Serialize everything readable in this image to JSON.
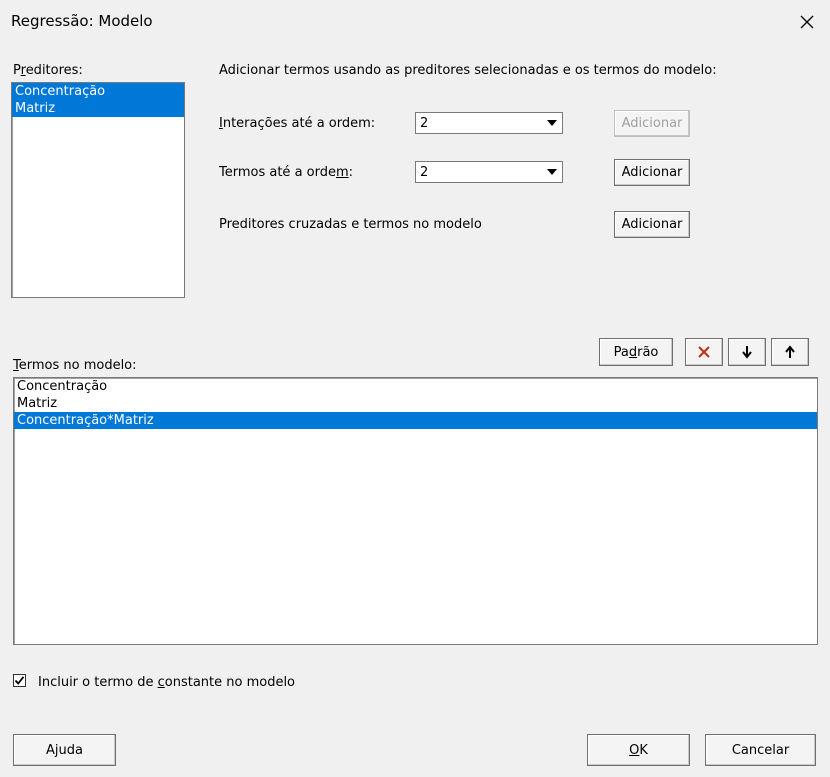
{
  "window": {
    "title": "Regressão: Modelo"
  },
  "predictors": {
    "label": "Preditores:",
    "items": [
      "Concentração",
      "Matriz"
    ]
  },
  "add_terms": {
    "heading": "Adicionar termos usando as preditores selecionadas e os termos do modelo:",
    "interactions_label": "Interações até a ordem:",
    "interactions_value": "2",
    "terms_label": "Termos até a ordem:",
    "terms_value": "2",
    "crossed_label": "Preditores cruzadas e termos no modelo",
    "add_button": "Adicionar"
  },
  "model_terms": {
    "label": "Termos no modelo:",
    "items": [
      "Concentração",
      "Matriz",
      "Concentração*Matriz"
    ],
    "default_button": "Padrão"
  },
  "constant": {
    "label": "Incluir o termo de constante no modelo",
    "checked": true
  },
  "footer": {
    "help": "Ajuda",
    "ok": "OK",
    "cancel": "Cancelar"
  },
  "icons": {
    "close": "close-icon",
    "delete": "delete-x-icon",
    "down": "arrow-down-icon",
    "up": "arrow-up-icon",
    "check": "checkmark-icon",
    "dropdown": "chevron-down-icon"
  },
  "colors": {
    "selection": "#0078d7",
    "background": "#f0f0f0",
    "delete_icon": "#c42b1c"
  }
}
